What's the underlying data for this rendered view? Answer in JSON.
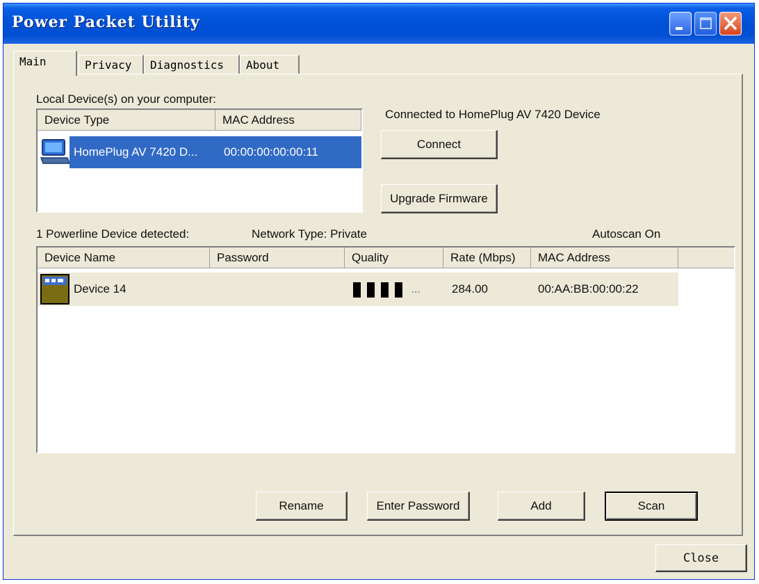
{
  "window": {
    "title": "Power Packet Utility"
  },
  "tabs": [
    {
      "label": "Main",
      "active": true
    },
    {
      "label": "Privacy",
      "active": false
    },
    {
      "label": "Diagnostics",
      "active": false
    },
    {
      "label": "About",
      "active": false
    }
  ],
  "local": {
    "label": "Local Device(s) on your computer:",
    "columns": [
      "Device Type",
      "MAC Address"
    ],
    "rows": [
      {
        "type": "HomePlug AV 7420 D...",
        "mac": "00:00:00:00:00:11",
        "icon": "computer-icon",
        "selected": true
      }
    ]
  },
  "connected_text": "Connected to HomePlug AV 7420 Device",
  "buttons": {
    "connect": "Connect",
    "upgrade": "Upgrade Firmware",
    "rename": "Rename",
    "enter_password": "Enter Password",
    "add": "Add",
    "scan": "Scan",
    "close": "Close"
  },
  "status": {
    "detected": "1 Powerline Device detected:",
    "network_type": "Network Type: Private",
    "autoscan": "Autoscan On"
  },
  "devices": {
    "columns": [
      "Device Name",
      "Password",
      "Quality",
      "Rate (Mbps)",
      "MAC Address"
    ],
    "rows": [
      {
        "name": "Device 14",
        "password": "",
        "quality_bars": 4,
        "quality_suffix": "...",
        "rate": "284.00",
        "mac": "00:AA:BB:00:00:22",
        "icon": "powerline-device-icon"
      }
    ]
  },
  "colors": {
    "title_bar": "#0052d6",
    "selection": "#316ac5",
    "window_bg": "#ece9d8"
  }
}
